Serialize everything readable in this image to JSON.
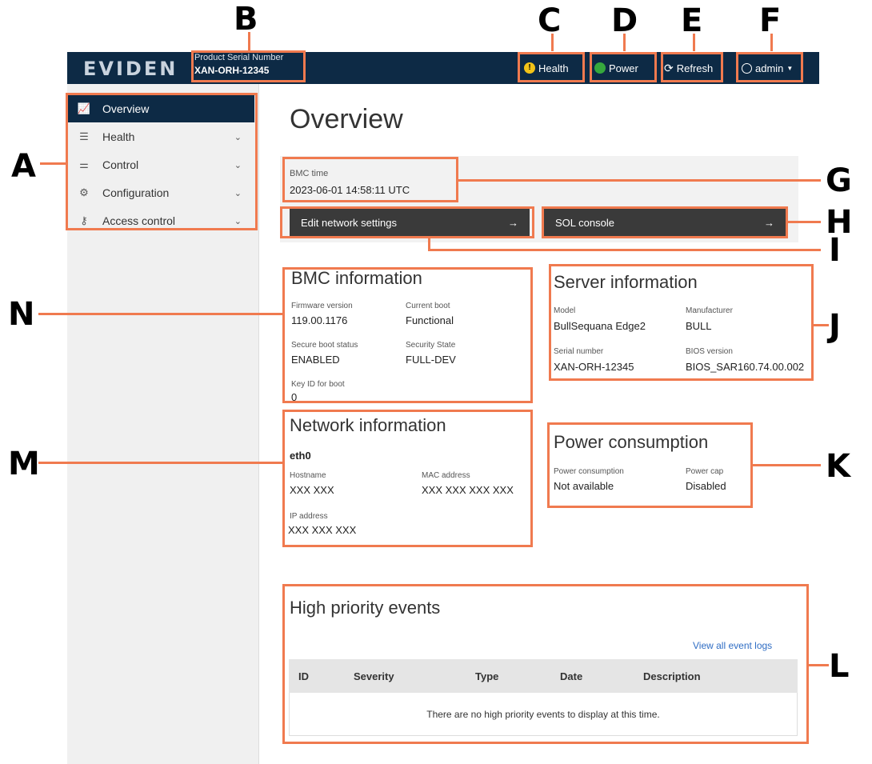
{
  "callouts": {
    "a": "A",
    "b": "B",
    "c": "C",
    "d": "D",
    "e": "E",
    "f": "F",
    "g": "G",
    "h": "H",
    "i": "I",
    "j": "J",
    "k": "K",
    "l": "L",
    "m": "M",
    "n": "N"
  },
  "header": {
    "logo": "EVIDEN",
    "serial_label": "Product Serial Number",
    "serial_value": "XAN-ORH-12345",
    "health_label": "Health",
    "power_label": "Power",
    "refresh_label": "Refresh",
    "user_label": "admin",
    "health_status_color": "#f2c318",
    "power_status_color": "#36a83d",
    "bar_color": "#0d2a45"
  },
  "sidebar": {
    "items": [
      {
        "label": "Overview",
        "icon": "chart-line-icon",
        "active": true
      },
      {
        "label": "Health",
        "icon": "clipboard-icon"
      },
      {
        "label": "Control",
        "icon": "sliders-icon"
      },
      {
        "label": "Configuration",
        "icon": "gear-icon"
      },
      {
        "label": "Access control",
        "icon": "key-icon"
      }
    ]
  },
  "main": {
    "title": "Overview",
    "bmc_time": {
      "label": "BMC time",
      "value": "2023-06-01 14:58:11 UTC"
    },
    "quick_links": {
      "edit_network": "Edit network settings",
      "sol_console": "SOL console",
      "arrow": "→"
    },
    "bmc_info": {
      "title": "BMC information",
      "firmware_label": "Firmware version",
      "firmware_value": "119.00.1176",
      "current_boot_label": "Current boot",
      "current_boot_value": "Functional",
      "secure_boot_label": "Secure boot status",
      "secure_boot_value": "ENABLED",
      "security_state_label": "Security State",
      "security_state_value": "FULL-DEV",
      "key_id_label": "Key ID for boot",
      "key_id_value": "0"
    },
    "server_info": {
      "title": "Server information",
      "model_label": "Model",
      "model_value": "BullSequana Edge2",
      "manufacturer_label": "Manufacturer",
      "manufacturer_value": "BULL",
      "serial_label": "Serial number",
      "serial_value": "XAN-ORH-12345",
      "bios_label": "BIOS version",
      "bios_value": "BIOS_SAR160.74.00.002"
    },
    "network_info": {
      "title": "Network information",
      "interface": "eth0",
      "hostname_label": "Hostname",
      "hostname_value": "XXX XXX",
      "mac_label": "MAC address",
      "mac_value": "XXX XXX XXX XXX",
      "ip_label": "IP address",
      "ip_value": "XXX XXX XXX"
    },
    "power_info": {
      "title": "Power consumption",
      "consumption_label": "Power consumption",
      "consumption_value": "Not available",
      "cap_label": "Power cap",
      "cap_value": "Disabled"
    },
    "events": {
      "title": "High priority events",
      "view_all": "View all event logs",
      "columns": [
        "ID",
        "Severity",
        "Type",
        "Date",
        "Description"
      ],
      "empty_message": "There are no high priority events to display at this time."
    }
  },
  "annotation_color": "#f07a4f"
}
